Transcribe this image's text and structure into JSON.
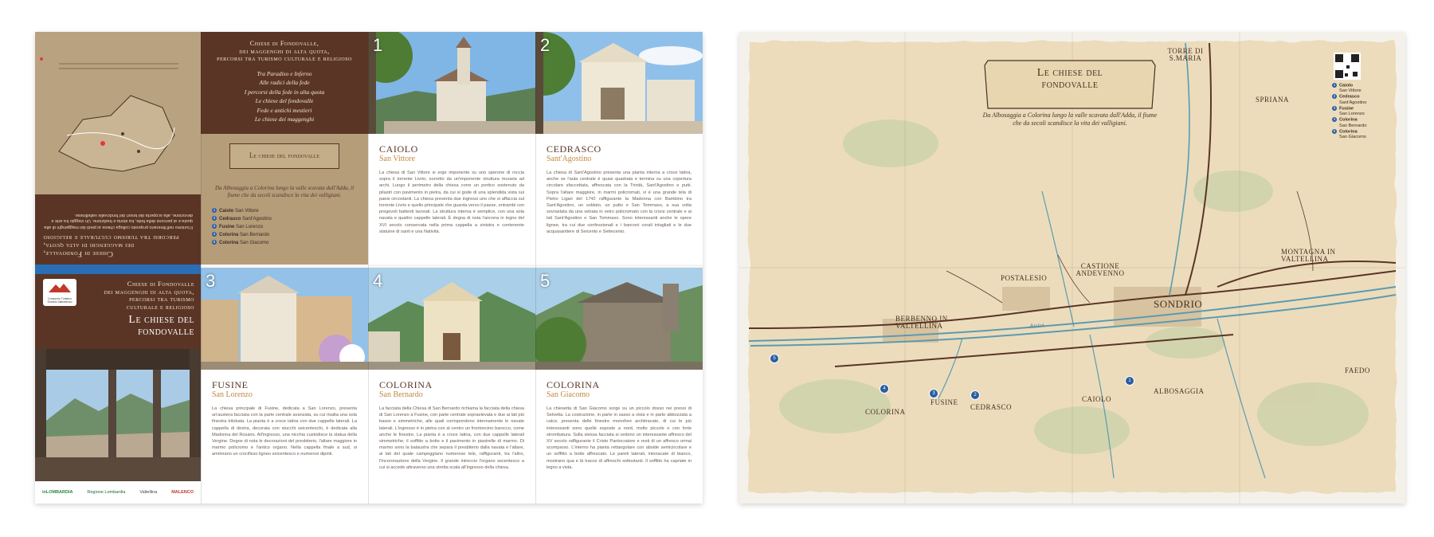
{
  "brochure": {
    "back_panel": {
      "upside_title_lines": [
        "Chiese di Fondovalle,",
        "dei maggenghi di alta quota,",
        "percorsi tra turismo culturale e religioso"
      ],
      "upside_body": "Il turismo nell'itinerario proposto collega chiese ai piedi dei maggenghi di alta quota e ai percorsi della fede, tra storia e tradizione. Un viaggio tra arte e devozione, alla scoperta dei tesori del fondovalle valtellinese."
    },
    "intro_panel": {
      "title_lines": [
        "Chiese di Fondovalle,",
        "dei maggenghi di alta quota,",
        "percorsi tra turismo culturale e religioso"
      ],
      "routes": [
        "Tra Paradiso e Inferno",
        "Alle radici della fede",
        "I percorsi della fede in alta quota",
        "Le chiese del fondovalle",
        "Fede e antichi mestieri",
        "Le chiese dei maggenghi"
      ],
      "banner_title": "Le chiese del fondovalle",
      "banner_subtitle": "Da Albosaggia a Colorina lungo la valle scavata dall'Adda, il fiume che da secoli scandisce la vita dei valligiani.",
      "list": [
        {
          "n": "1",
          "place": "Caiolo",
          "church": "San Vittore"
        },
        {
          "n": "2",
          "place": "Cedrasco",
          "church": "Sant'Agostino"
        },
        {
          "n": "3",
          "place": "Fusine",
          "church": "San Lorenzo"
        },
        {
          "n": "4",
          "place": "Colorina",
          "church": "San Bernardo"
        },
        {
          "n": "5",
          "place": "Colorina",
          "church": "San Giacomo"
        }
      ]
    },
    "cover": {
      "consortium": "Consorzio Turistico Sondrio Valmalenco",
      "title_lines": [
        "Chiese di Fondovalle",
        "dei maggenghi di alta quota,",
        "percorsi tra turismo",
        "culturale e religioso"
      ],
      "big_title_lines": [
        "Le chiese del",
        "fondovalle"
      ],
      "logos": [
        "inLOMBARDIA",
        "Regione Lombardia",
        "Valtellina",
        "MALENCO"
      ]
    },
    "churches": [
      {
        "n": "1",
        "place": "Caiolo",
        "church": "San Vittore",
        "text": "La chiesa di San Vittore si erge imponente su uno sperone di roccia sopra il torrente Livrio, sorretto da un'imponente struttura muraria ad archi. Lungo il perimetro della chiesa corre un portico sostenuto da pilastri con pavimento in pietra, da cui si gode di una splendida vista sui paesi circostanti. La chiesa presenta due ingressi uno che si affaccia sul torrente Livrio e quello principale che guarda verso il paese, entrambi con pregevoli battenti lavorati. La struttura interna è semplice, con una sola navata e quattro cappelle laterali. È degna di nota l'ancona in legno del XVI secolo conservata nella prima cappella a sinistra e contenente statuine di santi e una Natività."
      },
      {
        "n": "2",
        "place": "Cedrasco",
        "church": "Sant'Agostino",
        "text": "La chiesa di Sant'Agostino presenta una pianta interna a croce latina, anche se l'aula centrale è quasi quadrata e termina su una copertura circolare sfaccettata, affrescata con la Trinità, Sant'Agostino e putti. Sopra l'altare maggiore, in marmi policromati, vi è una grande tela di Pietro Ligari del 1742 raffigurante la Madonna con Bambino tra Sant'Agostino, un soldato, un putto e San Tommaso, a sua volta sovrastata da una vetrata in vetro policromato con la croce centrale e ai lati Sant'Agostino e San Tommaso. Sono interessanti anche le opere lignee, tra cui due confessionali e i banconi corali intagliati e le due acquasantiere di Seicento e Settecento."
      },
      {
        "n": "3",
        "place": "Fusine",
        "church": "San Lorenzo",
        "text": "La chiesa principale di Fusine, dedicata a San Lorenzo, presenta un'austera facciata con la parte centrale avanzata, su cui risalta una sola finestra trilobata. La pianta è a croce latina con due cappelle laterali. La cappella di destra, decorata con stucchi seicenteschi, è dedicata alla Madonna del Rosario. All'ingresso, una nicchia custodisce la statua della Vergine. Degne di nota le decorazioni del presbiterio, l'altare maggiore in marmo policromo e l'antico organo. Nella cappella finale a sud, si ammirano un crocifisso ligneo seicentesco e numerosi dipinti."
      },
      {
        "n": "4",
        "place": "Colorina",
        "church": "San Bernardo",
        "text": "La facciata della Chiesa di San Bernardo richiama la facciata della chiesa di San Lorenzo a Fusine, con parte centrale sopraelevata e due ai lati più basse e simmetriche, alle quali corrispondono internamente le navate laterali. L'ingresso è in pietra con al centro un frontoncino barocco, come anche le finestre. La pianta è a croce latina, con due cappelle laterali simmetriche; il soffitto a botte e il pavimento in piastrelle di marmo. Di marmo sono la balaustra che separa il presbiterio dalla navata e l'altare, ai lati del quale campeggiano numerose tele, raffiguranti, tra l'altro, l'Incoronazione della Vergine. Il grande intreccio l'organo secentesco a cui si accede attraverso una stretta scala all'ingresso della chiesa."
      },
      {
        "n": "5",
        "place": "Colorina",
        "church": "San Giacomo",
        "text": "La chiesetta di San Giacomo sorge su un piccolo dosso nei pressi di Selvetta. La costruzione, in parte in sasso a vista e in parte abbozzata a calce, presenta delle finestre monofore architravate, di cui le più interessanti sono quelle esposte a nord, molto piccole e con forte strombatura. Sulla stessa facciata si vedono un interessante affresco del XV secolo raffigurante il Cristo Pantocratore e resti di un affresco ormai scomparso. L'interno ha pianta rettangolare con abside semicircolare e un soffitto a botte affrescato. Le pareti laterali, intonacate di bianco, mostrano qua e là tracce di affreschi sottostanti. Il soffitto ha capriate in legno a vista."
      }
    ]
  },
  "map": {
    "title_lines": [
      "Le chiese del",
      "fondovalle"
    ],
    "subtitle": "Da Albosaggia a Colorina lungo la valle scavata dall'Adda, il fiume che da secoli scandisce la vita dei valligiani.",
    "legend": [
      {
        "n": "1",
        "place": "Caiolo",
        "church": "San Vittore"
      },
      {
        "n": "2",
        "place": "Cedrasco",
        "church": "Sant'Agostino"
      },
      {
        "n": "3",
        "place": "Fusine",
        "church": "San Lorenzo"
      },
      {
        "n": "4",
        "place": "Colorina",
        "church": "San Bernardo"
      },
      {
        "n": "5",
        "place": "Colorina",
        "church": "San Giacomo"
      }
    ],
    "places": {
      "torre": "Torre di S.Maria",
      "spriana": "Spriana",
      "montagna": "Montagna in Valtellina",
      "castione": "Castione Andevenno",
      "postalesio": "Postalesio",
      "sondrio": "Sondrio",
      "berbenno": "Berbenno in Valtellina",
      "faedo": "Faedo",
      "albosaggia": "Albosaggia",
      "caiolo": "Caiolo",
      "cedrasco": "Cedrasco",
      "fusine": "Fusine",
      "colorina": "Colorina",
      "adda": "Adda"
    },
    "colors": {
      "paper": "#ecdcbc",
      "river": "#5b9bb0",
      "road": "#5a3526",
      "pin": "#2a5d9f"
    }
  }
}
